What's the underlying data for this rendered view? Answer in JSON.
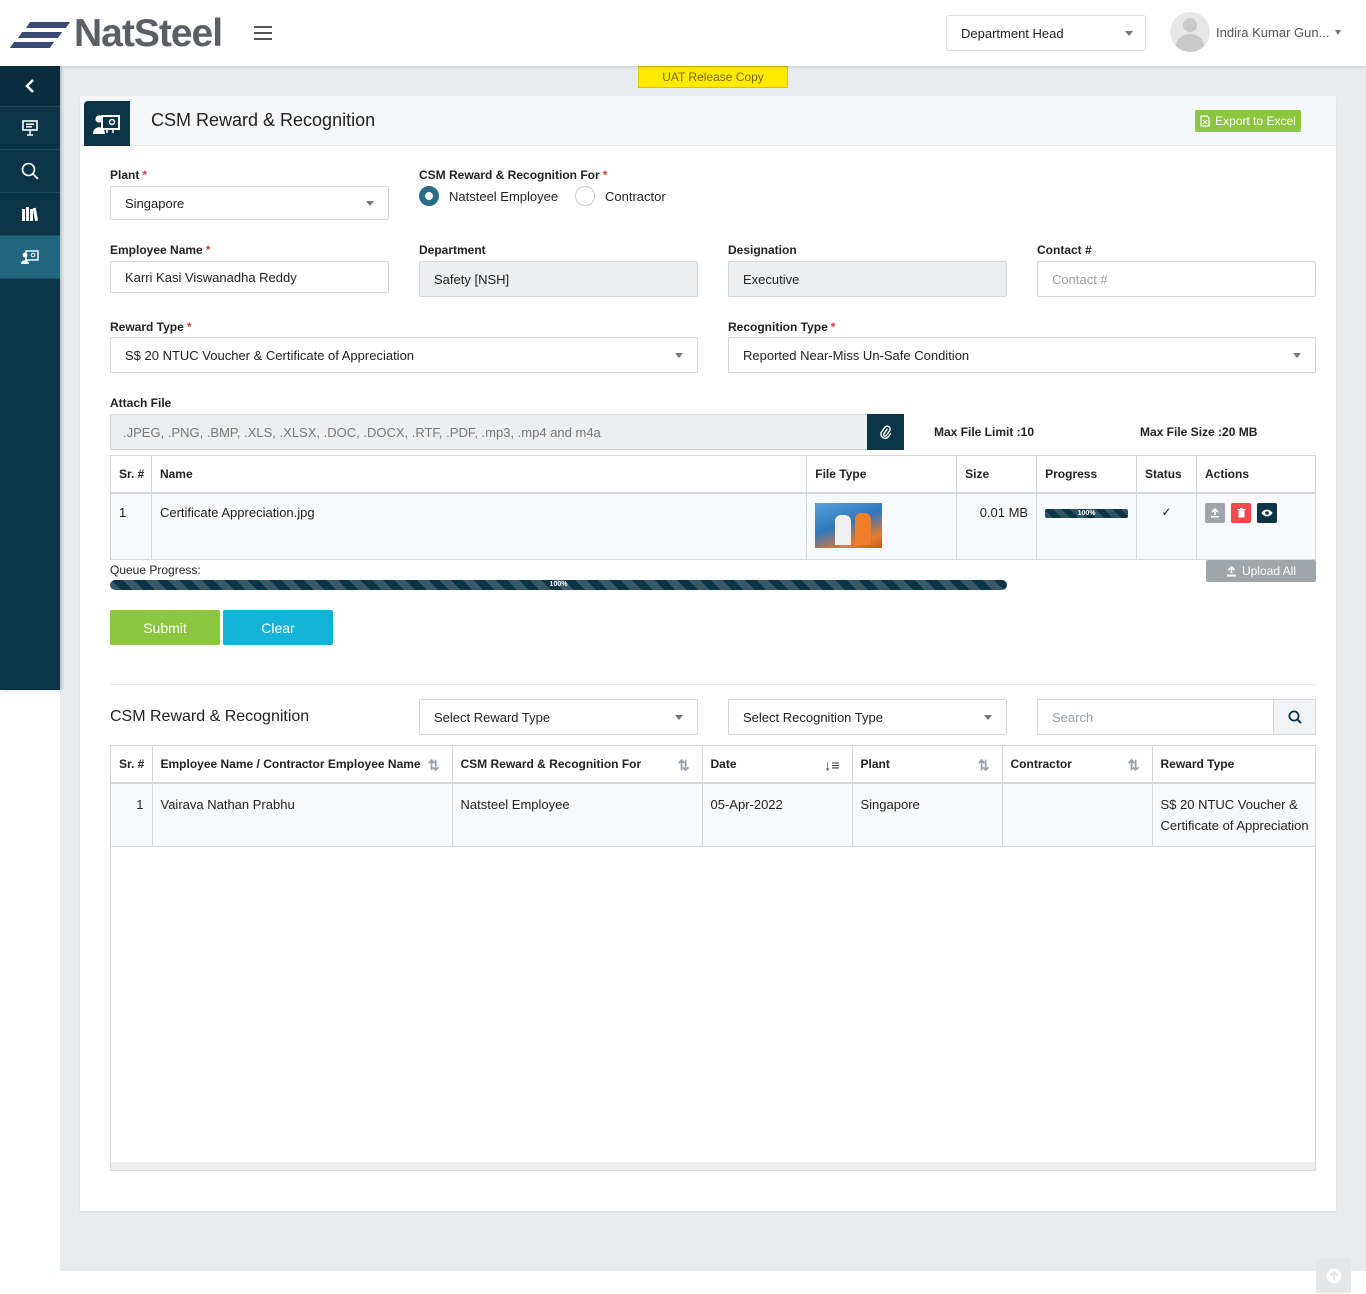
{
  "header": {
    "logo_text": "NatSteel",
    "role": "Department Head",
    "user_name": "Indira Kumar Gun..."
  },
  "banner": "UAT Release Copy",
  "page": {
    "title": "CSM Reward & Recognition",
    "export_label": "Export to Excel"
  },
  "sidebar": {
    "items": [
      {
        "icon": "chevron-left-icon"
      },
      {
        "icon": "presentation-icon"
      },
      {
        "icon": "search-icon"
      },
      {
        "icon": "library-icon"
      },
      {
        "icon": "reward-recognition-icon",
        "active": true
      }
    ]
  },
  "form": {
    "plant_label": "Plant",
    "plant_value": "Singapore",
    "for_label": "CSM Reward & Recognition For",
    "for_options": [
      "Natsteel Employee",
      "Contractor"
    ],
    "for_selected": "Natsteel Employee",
    "employee_label": "Employee Name",
    "employee_value": "Karri Kasi Viswanadha Reddy",
    "department_label": "Department",
    "department_value": "Safety [NSH]",
    "designation_label": "Designation",
    "designation_value": "Executive",
    "contact_label": "Contact #",
    "contact_placeholder": "Contact #",
    "reward_label": "Reward Type",
    "reward_value": "S$ 20 NTUC Voucher & Certificate of Appreciation",
    "recognition_label": "Recognition Type",
    "recognition_value": "Reported Near-Miss Un-Safe Condition",
    "attach_label": "Attach File",
    "attach_placeholder": ".JPEG, .PNG, .BMP, .XLS, .XLSX, .DOC, .DOCX, .RTF, .PDF, .mp3, .mp4 and m4a",
    "max_file_limit": "Max File Limit :10",
    "max_file_size": "Max File Size :20 MB"
  },
  "files": {
    "headers": [
      "Sr. #",
      "Name",
      "File Type",
      "Size",
      "Progress",
      "Status",
      "Actions"
    ],
    "rows": [
      {
        "sr": "1",
        "name": "Certificate Appreciation.jpg",
        "size": "0.01 MB",
        "progress_pct": 100,
        "progress_label": "100%",
        "status": "✓"
      }
    ]
  },
  "queue": {
    "label": "Queue Progress:",
    "progress_pct": 100,
    "progress_label": "100%",
    "upload_all": "Upload All"
  },
  "buttons": {
    "submit": "Submit",
    "clear": "Clear"
  },
  "list": {
    "title": "CSM Reward & Recognition",
    "reward_filter": "Select Reward Type",
    "recognition_filter": "Select Recognition Type",
    "search_placeholder": "Search",
    "headers": [
      "Sr. #",
      "Employee Name / Contractor Employee Name",
      "CSM Reward & Recognition For",
      "Date",
      "Plant",
      "Contractor",
      "Reward Type"
    ],
    "rows": [
      {
        "sr": "1",
        "employee": "Vairava Nathan Prabhu",
        "for": "Natsteel Employee",
        "date": "05-Apr-2022",
        "plant": "Singapore",
        "contractor": "",
        "reward": "S$ 20 NTUC Voucher & Certificate of Appreciation"
      }
    ]
  },
  "colors": {
    "sidebar": "#0c3447",
    "sidebar_active": "#22657f",
    "submit": "#8cc63f",
    "clear": "#12b3d6",
    "banner": "#ffea00",
    "danger": "#ef4b4b"
  }
}
